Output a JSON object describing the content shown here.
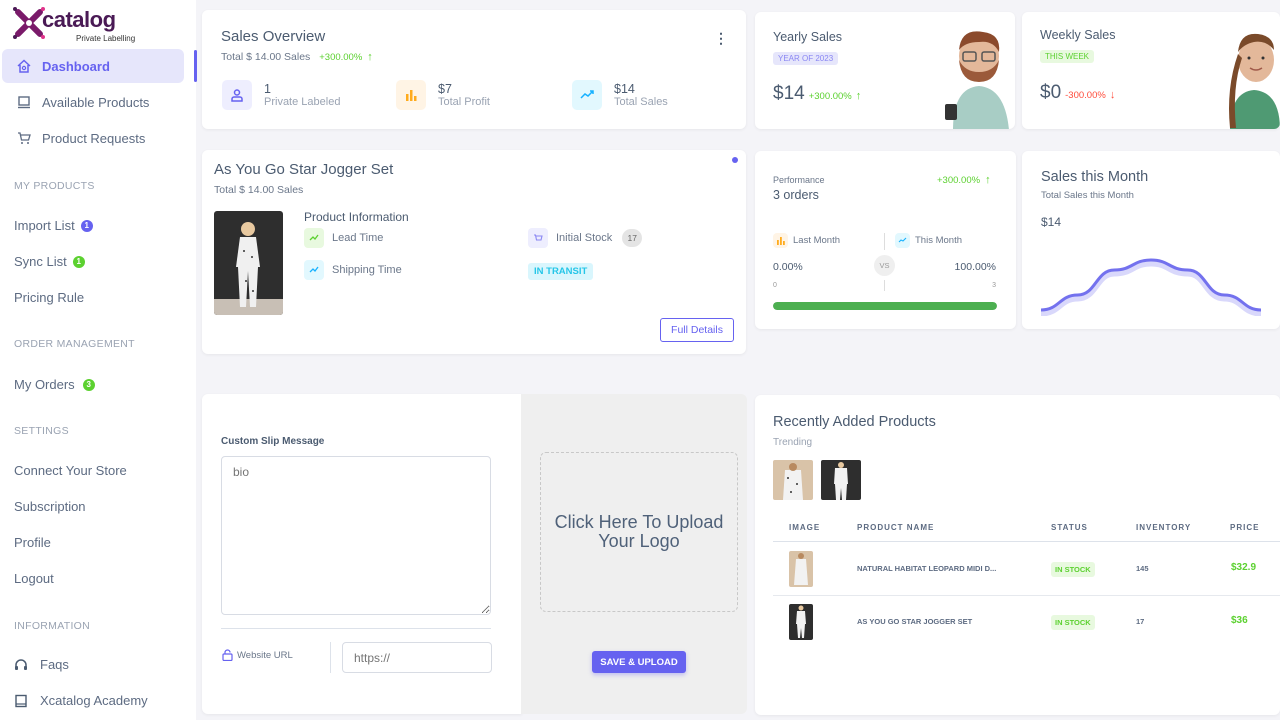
{
  "brand": {
    "name": "catalog",
    "prefix": "X",
    "tagline": "Private Labelling"
  },
  "sidebar": {
    "primary": [
      {
        "label": "Dashboard",
        "icon": "home-icon",
        "active": true
      },
      {
        "label": "Available Products",
        "icon": "laptop-icon"
      },
      {
        "label": "Product Requests",
        "icon": "cart-icon"
      }
    ],
    "sections": [
      {
        "title": "MY PRODUCTS",
        "items": [
          {
            "label": "Import List",
            "badge": "1",
            "badge_color": "#6662f0"
          },
          {
            "label": "Sync List",
            "badge": "1",
            "badge_color": "#5cd130"
          },
          {
            "label": "Pricing Rule"
          }
        ]
      },
      {
        "title": "ORDER MANAGEMENT",
        "items": [
          {
            "label": "My Orders",
            "badge": "3",
            "badge_color": "#5cd130"
          }
        ]
      },
      {
        "title": "SETTINGS",
        "items": [
          {
            "label": "Connect Your Store"
          },
          {
            "label": "Subscription"
          },
          {
            "label": "Profile"
          },
          {
            "label": "Logout"
          }
        ]
      },
      {
        "title": "INFORMATION",
        "items": [
          {
            "label": "Faqs",
            "icon": "headset-icon"
          },
          {
            "label": "Xcatalog Academy",
            "icon": "book-icon"
          }
        ]
      }
    ]
  },
  "sales_overview": {
    "title": "Sales Overview",
    "subtitle": "Total $ 14.00 Sales",
    "change": "+300.00%",
    "stats": [
      {
        "value": "1",
        "label": "Private Labeled",
        "icon": "user-icon"
      },
      {
        "value": "$7",
        "label": "Total Profit",
        "icon": "bar-chart-icon"
      },
      {
        "value": "$14",
        "label": "Total Sales",
        "icon": "trending-up-icon"
      }
    ]
  },
  "yearly_sales": {
    "title": "Yearly Sales",
    "badge": "YEAR OF 2023",
    "value": "$14",
    "change": "+300.00%"
  },
  "weekly_sales": {
    "title": "Weekly Sales",
    "badge": "THIS WEEK",
    "value": "$0",
    "change": "-300.00%"
  },
  "product_card": {
    "title": "As You Go Star Jogger Set",
    "subtitle": "Total $ 14.00 Sales",
    "info_title": "Product Information",
    "lead_time": "Lead Time",
    "shipping_time": "Shipping Time",
    "initial_stock_label": "Initial Stock",
    "initial_stock": "17",
    "status": "IN TRANSIT",
    "full_details": "Full Details"
  },
  "performance": {
    "label": "Performance",
    "orders": "3 orders",
    "change": "+300.00%",
    "last_month_label": "Last Month",
    "this_month_label": "This Month",
    "last_month_pct": "0.00%",
    "this_month_pct": "100.00%",
    "vs": "VS",
    "min": "0",
    "max": "3",
    "progress_pct": 100
  },
  "sales_month": {
    "title": "Sales this Month",
    "subtitle": "Total Sales this Month",
    "value": "$14",
    "chart_data": {
      "type": "line",
      "values": [
        0,
        0.3,
        0.8,
        1,
        0.8,
        0.3,
        0
      ]
    }
  },
  "slip": {
    "label": "Custom Slip Message",
    "placeholder": "bio",
    "website_label": "Website URL",
    "website_placeholder": "https://",
    "upload_text": "Click Here To Upload Your Logo",
    "save_button": "SAVE & UPLOAD"
  },
  "recent": {
    "title": "Recently Added Products",
    "subtitle": "Trending",
    "columns": [
      "IMAGE",
      "PRODUCT NAME",
      "STATUS",
      "INVENTORY",
      "PRICE"
    ],
    "rows": [
      {
        "name": "NATURAL HABITAT LEOPARD MIDI D...",
        "status": "IN STOCK",
        "inventory": "145",
        "price": "$32.9"
      },
      {
        "name": "AS YOU GO STAR JOGGER SET",
        "status": "IN STOCK",
        "inventory": "17",
        "price": "$36"
      }
    ]
  }
}
